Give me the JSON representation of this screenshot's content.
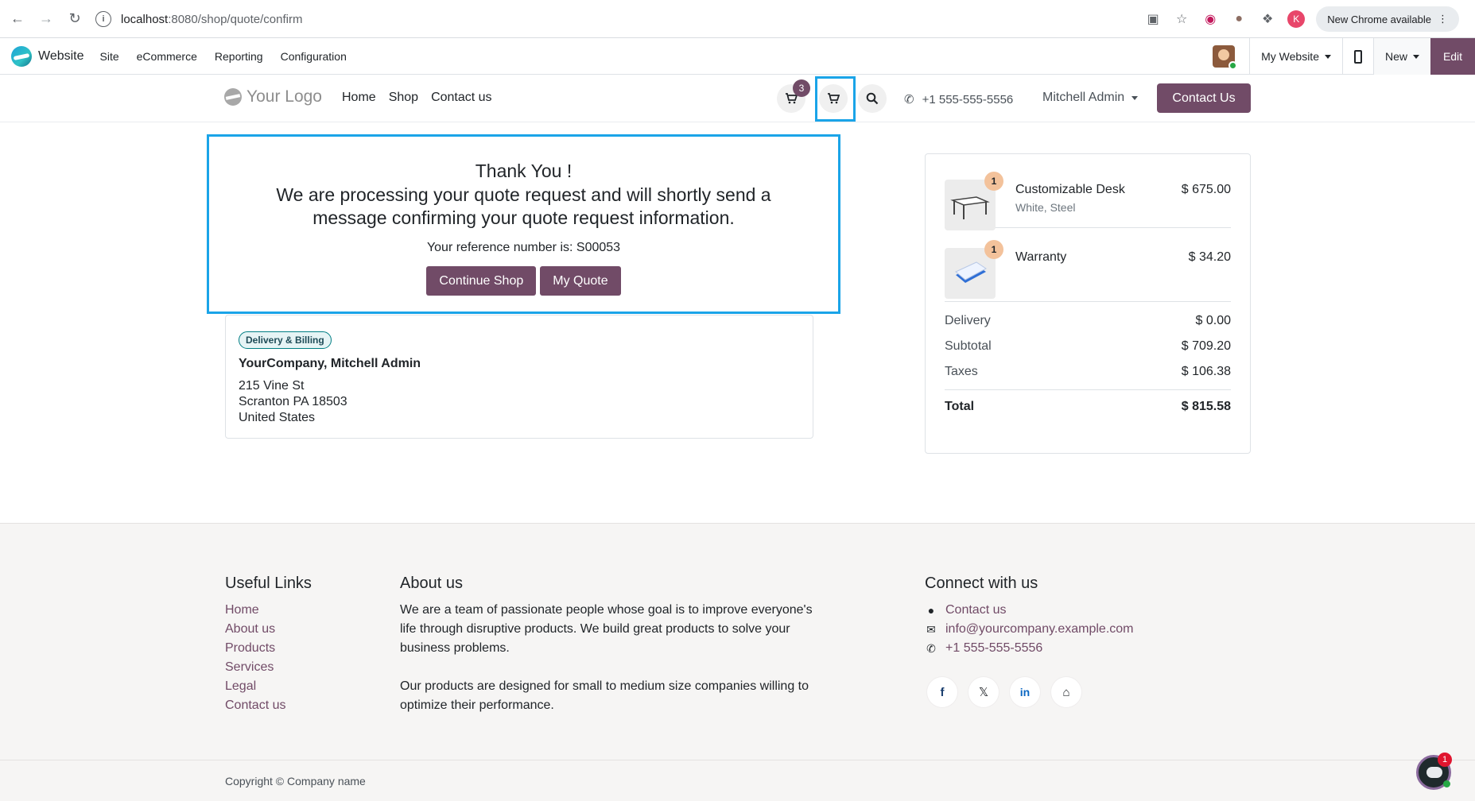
{
  "browser": {
    "url_host": "localhost",
    "url_path": ":8080/shop/quote/confirm",
    "profile_initial": "K",
    "update_label": "New Chrome available"
  },
  "odoo_bar": {
    "app_name": "Website",
    "menu": [
      "Site",
      "eCommerce",
      "Reporting",
      "Configuration"
    ],
    "website_switcher": "My Website",
    "new_label": "New",
    "edit_label": "Edit"
  },
  "site_header": {
    "logo_text": "Your Logo",
    "nav": [
      "Home",
      "Shop",
      "Contact us"
    ],
    "wishlist_count": "3",
    "phone": "+1 555-555-5556",
    "user_name": "Mitchell Admin",
    "cta_label": "Contact Us"
  },
  "confirmation": {
    "title": "Thank You !",
    "message": "We are processing your quote request and will shortly send a message confirming your quote request information.",
    "reference": "Your reference number is: S00053",
    "continue_label": "Continue Shop",
    "quote_label": "My Quote"
  },
  "address": {
    "badge": "Delivery & Billing",
    "name": "YourCompany, Mitchell Admin",
    "lines": [
      "215 Vine St",
      "Scranton PA 18503",
      "United States"
    ]
  },
  "summary": {
    "items": [
      {
        "qty": "1",
        "name": "Customizable Desk",
        "variant": "White, Steel",
        "price": "$ 675.00"
      },
      {
        "qty": "1",
        "name": "Warranty",
        "variant": "",
        "price": "$ 34.20"
      }
    ],
    "totals": [
      {
        "label": "Delivery",
        "value": "$ 0.00"
      },
      {
        "label": "Subtotal",
        "value": "$ 709.20"
      },
      {
        "label": "Taxes",
        "value": "$ 106.38"
      }
    ],
    "total_label": "Total",
    "total_value": "$ 815.58"
  },
  "footer": {
    "useful_links_title": "Useful Links",
    "useful_links": [
      "Home",
      "About us",
      "Products",
      "Services",
      "Legal",
      "Contact us"
    ],
    "about_title": "About us",
    "about_p1": "We are a team of passionate people whose goal is to improve everyone's life through disruptive products. We build great products to solve your business problems.",
    "about_p2": "Our products are designed for small to medium size companies willing to optimize their performance.",
    "connect_title": "Connect with us",
    "contact_link": "Contact us",
    "email": "info@yourcompany.example.com",
    "phone": "+1 555-555-5556",
    "social_icons": [
      "facebook-icon",
      "x-icon",
      "linkedin-icon",
      "home-icon"
    ],
    "copyright": "Copyright © Company name"
  },
  "chat": {
    "unread": "1"
  },
  "colors": {
    "brand": "#714b67",
    "highlight": "#1aa4e8"
  }
}
